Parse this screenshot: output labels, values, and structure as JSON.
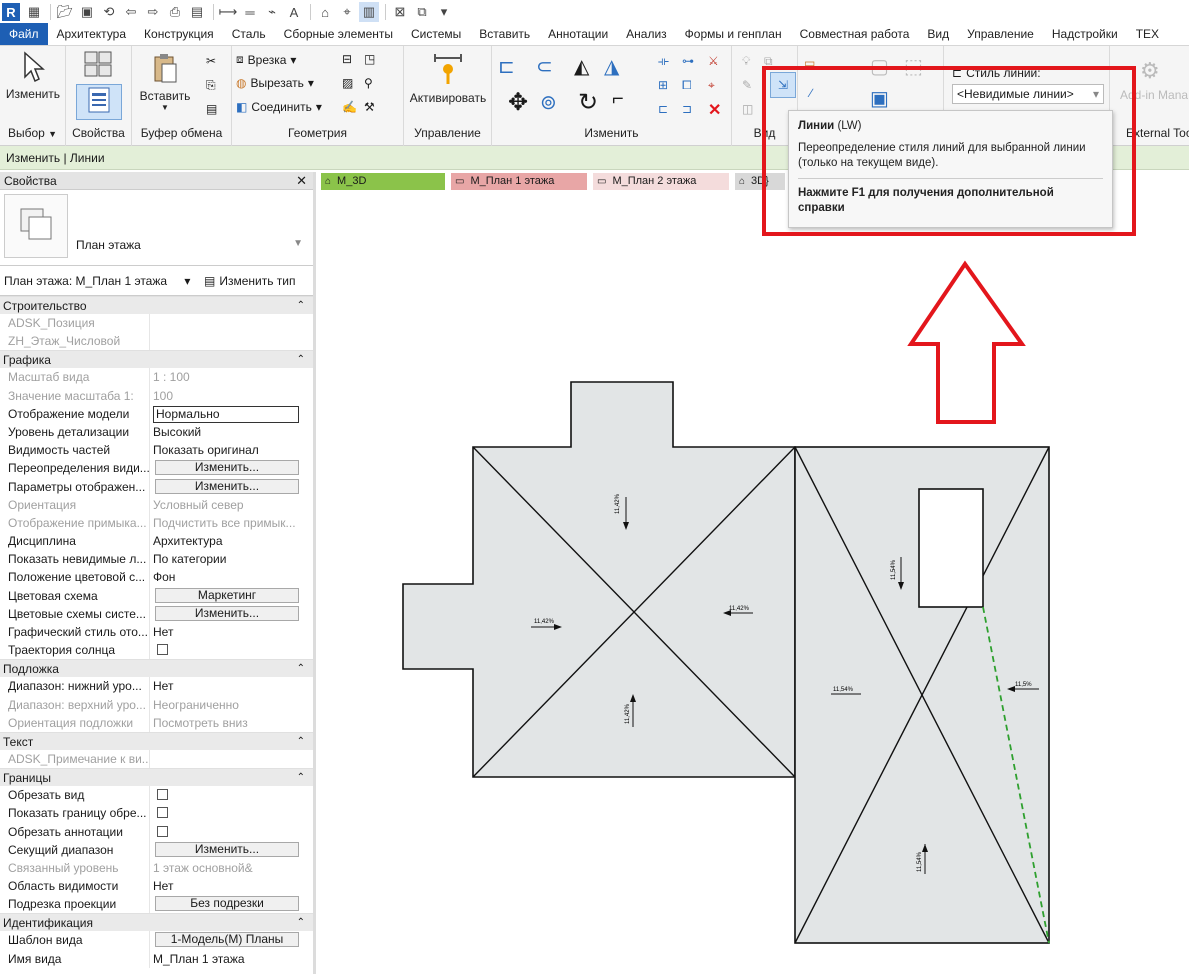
{
  "app": {
    "logo": "R"
  },
  "qat": {
    "icons": [
      "open-icon",
      "save-icon",
      "sync-icon",
      "undo-icon",
      "redo-icon",
      "print-icon",
      "measure-icon",
      "align-icon",
      "text-icon",
      "home-icon",
      "switch-windows-icon"
    ],
    "text_tool": "A"
  },
  "tabs": [
    "Файл",
    "Архитектура",
    "Конструкция",
    "Сталь",
    "Сборные элементы",
    "Системы",
    "Вставить",
    "Аннотации",
    "Анализ",
    "Формы и генплан",
    "Совместная работа",
    "Вид",
    "Управление",
    "Надстройки",
    "TEX"
  ],
  "ribbon": {
    "modify_label": "Изменить",
    "select_label": "Выбор",
    "properties_label": "Свойства",
    "paste_label": "Вставить",
    "clipboard_label": "Буфер обмена",
    "geometry": {
      "cut_label": "Врезка",
      "cutout_label": "Вырезать",
      "join_label": "Соединить",
      "label": "Геометрия"
    },
    "activate_label": "Активировать",
    "manage_label": "Управление",
    "modify_panel_label": "Изменить",
    "view_label": "Вид",
    "line_style": {
      "label": "Стиль линий:",
      "value": "<Невидимые линии>"
    },
    "addin_label": "Add-in Mana",
    "external_label": "External Too",
    "dropdown_arrow": "▼",
    "submenu_arrow": "▾"
  },
  "context": {
    "breadcrumb": "Изменить | Линии"
  },
  "tooltip": {
    "title": "Линии",
    "shortcut": "(LW)",
    "description": "Переопределение стиля линий для выбранной линии (только на текущем виде).",
    "help": "Нажмите F1 для получения дополнительной справки"
  },
  "properties": {
    "title": "Свойства",
    "close": "✕",
    "type_name": "План этажа",
    "selector_label": "План этажа: М_План 1 этажа",
    "edit_type": "Изменить тип",
    "groups": [
      {
        "name": "Строительство",
        "rows": [
          {
            "k": "ADSK_Позиция",
            "v": "",
            "dim": true
          },
          {
            "k": "ZH_Этаж_Числовой",
            "v": "",
            "dim": true
          }
        ]
      },
      {
        "name": "Графика",
        "rows": [
          {
            "k": "Масштаб вида",
            "v": "1 : 100",
            "dim": true
          },
          {
            "k": "Значение масштаба    1:",
            "v": "100",
            "dim": true
          },
          {
            "k": "Отображение модели",
            "v": "Нормально",
            "box": true
          },
          {
            "k": "Уровень детализации",
            "v": "Высокий"
          },
          {
            "k": "Видимость частей",
            "v": "Показать оригинал"
          },
          {
            "k": "Переопределения види...",
            "v": "Изменить...",
            "btn": true
          },
          {
            "k": "Параметры отображен...",
            "v": "Изменить...",
            "btn": true
          },
          {
            "k": "Ориентация",
            "v": "Условный север",
            "dim": true
          },
          {
            "k": "Отображение примыка...",
            "v": "Подчистить все примык...",
            "dim": true
          },
          {
            "k": "Дисциплина",
            "v": "Архитектура"
          },
          {
            "k": "Показать невидимые л...",
            "v": "По категории"
          },
          {
            "k": "Положение цветовой с...",
            "v": "Фон"
          },
          {
            "k": "Цветовая схема",
            "v": "Маркетинг",
            "btn": true
          },
          {
            "k": "Цветовые схемы систе...",
            "v": "Изменить...",
            "btn": true
          },
          {
            "k": "Графический стиль ото...",
            "v": "Нет"
          },
          {
            "k": "Траектория солнца",
            "v": "",
            "cb": true
          }
        ]
      },
      {
        "name": "Подложка",
        "rows": [
          {
            "k": "Диапазон: нижний уро...",
            "v": "Нет"
          },
          {
            "k": "Диапазон: верхний уро...",
            "v": "Неограниченно",
            "dim": true
          },
          {
            "k": "Ориентация подложки",
            "v": "Посмотреть вниз",
            "dim": true
          }
        ]
      },
      {
        "name": "Текст",
        "rows": [
          {
            "k": "ADSK_Примечание к ви...",
            "v": "",
            "dim": true
          }
        ]
      },
      {
        "name": "Границы",
        "rows": [
          {
            "k": "Обрезать вид",
            "v": "",
            "cb": true
          },
          {
            "k": "Показать границу обре...",
            "v": "",
            "cb": true
          },
          {
            "k": "Обрезать аннотации",
            "v": "",
            "cb": true
          },
          {
            "k": "Секущий диапазон",
            "v": "Изменить...",
            "btn": true
          },
          {
            "k": "Связанный уровень",
            "v": "1 этаж основной&",
            "dim": true
          },
          {
            "k": "Область видимости",
            "v": "Нет"
          },
          {
            "k": "Подрезка проекции",
            "v": "Без подрезки",
            "btn": true
          }
        ]
      },
      {
        "name": "Идентификация",
        "rows": [
          {
            "k": "Шаблон вида",
            "v": "1-Модель(М) Планы",
            "btn": true
          },
          {
            "k": "Имя вида",
            "v": "М_План 1 этажа"
          }
        ]
      }
    ],
    "collapse": "⌃"
  },
  "view_tabs": [
    {
      "label": "М_3D",
      "color": "#8bc34a"
    },
    {
      "label": "М_План 1 этажа",
      "color": "#e8a6a6"
    },
    {
      "label": "М_План 2 этажа",
      "color": "#f4dcdc"
    },
    {
      "label": "3D}",
      "color": "#d8d8d8"
    }
  ],
  "plan": {
    "fill": "#e2e5e6",
    "slopes": [
      "11,42%",
      "11,42%",
      "11,42%",
      "11,42%",
      "11,54%",
      "11,5%",
      "11,54%",
      "11,54%"
    ],
    "accent": "#e3161c",
    "dash_color": "#2ea02e"
  }
}
